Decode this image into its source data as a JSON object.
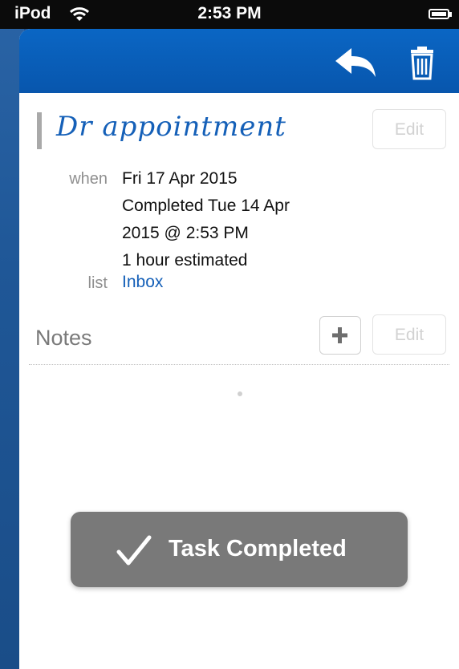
{
  "status_bar": {
    "carrier": "iPod",
    "time": "2:53 PM"
  },
  "nav_bar": {
    "icons": [
      "reply-icon",
      "trash-icon"
    ],
    "color": "#0a66c4"
  },
  "task": {
    "title": "Dr appointment",
    "edit_label": "Edit",
    "when_label": "when",
    "when_lines": [
      "Fri 17 Apr 2015",
      "Completed Tue 14 Apr",
      "2015 @ 2:53 PM",
      "1 hour estimated"
    ],
    "list_label": "list",
    "list_value": "Inbox"
  },
  "notes": {
    "heading": "Notes",
    "add_icon": "plus-icon",
    "edit_label": "Edit"
  },
  "toast": {
    "icon": "checkmark-icon",
    "text": "Task Completed"
  }
}
